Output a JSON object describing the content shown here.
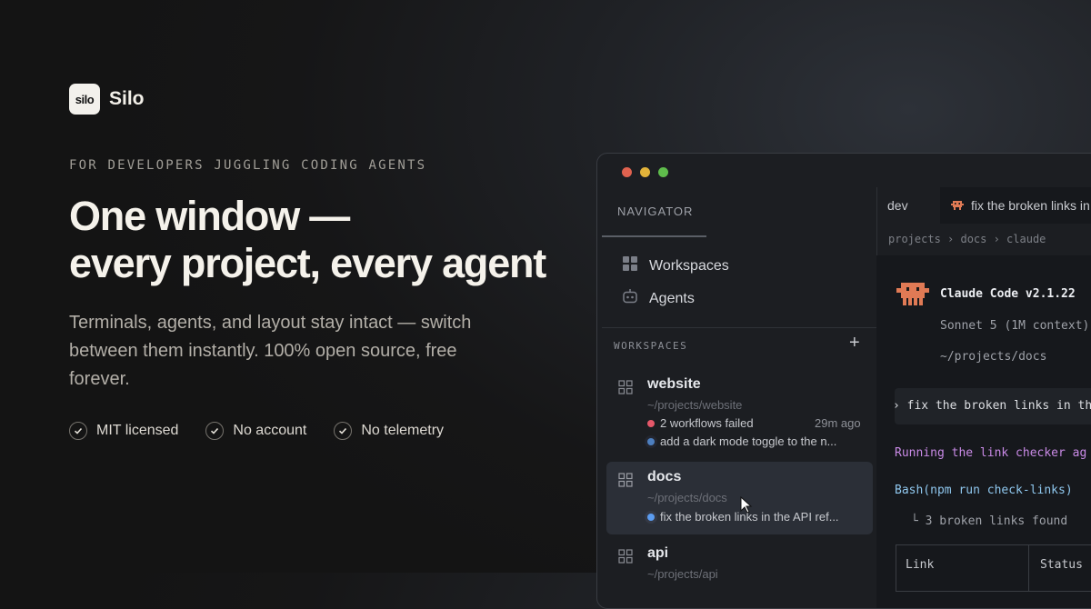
{
  "brand": {
    "logo_text": "silo",
    "name": "Silo"
  },
  "hero": {
    "eyebrow": "FOR DEVELOPERS JUGGLING CODING AGENTS",
    "headline_line1": "One window —",
    "headline_line2": "every project, every agent",
    "subtitle": "Terminals, agents, and layout stay intact — switch between them instantly. 100% open source, free forever.",
    "checks": [
      "MIT licensed",
      "No account",
      "No telemetry"
    ]
  },
  "window": {
    "navigator": {
      "title": "NAVIGATOR",
      "items": [
        {
          "label": "Workspaces",
          "icon": "grid-icon"
        },
        {
          "label": "Agents",
          "icon": "robot-icon"
        }
      ],
      "workspaces_label": "WORKSPACES",
      "add_label": "+",
      "workspaces": [
        {
          "name": "website",
          "path": "~/projects/website",
          "status": "2 workflows failed",
          "time": "29m ago",
          "task": "add a dark mode toggle to the n..."
        },
        {
          "name": "docs",
          "path": "~/projects/docs",
          "task": "fix the broken links in the API ref..."
        },
        {
          "name": "api",
          "path": "~/projects/api"
        }
      ]
    },
    "tabs": [
      {
        "label": "dev"
      },
      {
        "label": "fix the broken links in"
      }
    ],
    "breadcrumb": "projects › docs › claude",
    "terminal": {
      "header": "Claude Code v2.1.22",
      "model": "Sonnet 5 (1M context)",
      "cwd": "~/projects/docs",
      "prompt": "› fix the broken links in the",
      "running": "Running the link checker ag",
      "bash": "Bash(npm run check-links)",
      "result": "└ 3 broken links found",
      "table_headers": [
        "Link",
        "Status"
      ]
    }
  },
  "colors": {
    "accent_red": "#e5586a",
    "accent_blue": "#5b9cf0",
    "claude_orange": "#e07a55",
    "purple": "#c98ae6",
    "cyan": "#8fc7ee"
  }
}
